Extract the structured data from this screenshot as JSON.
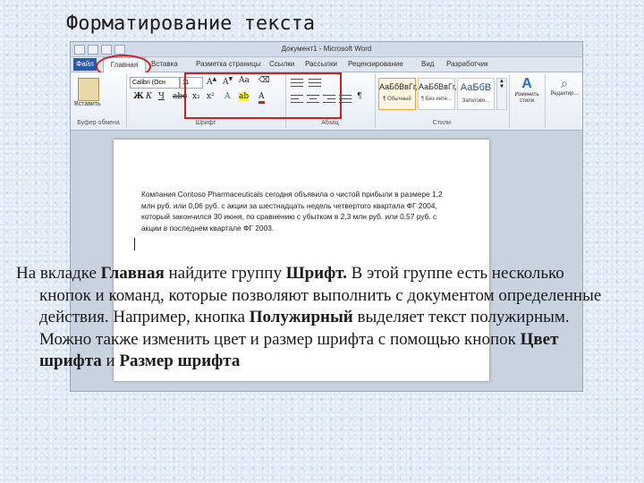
{
  "slide": {
    "title": "Форматирование текста"
  },
  "window": {
    "title": "Документ1 - Microsoft Word"
  },
  "tabs": {
    "file": "Файл",
    "home": "Главная",
    "items": [
      "Вставка",
      "Разметка страницы",
      "Ссылки",
      "Рассылки",
      "Рецензирование",
      "Вид",
      "Разработчик"
    ]
  },
  "ribbon": {
    "clipboard": {
      "paste_label": "Вставить",
      "group_label": "Буфер обмена"
    },
    "font": {
      "font_name": "Calibri (Осн",
      "font_size": "11",
      "group_label": "Шрифт"
    },
    "paragraph": {
      "group_label": "Абзац"
    },
    "styles": {
      "items": [
        {
          "sample": "АаБбВвГг,",
          "name": "¶ Обычный"
        },
        {
          "sample": "АаБбВвГг,",
          "name": "¶ Без инте..."
        },
        {
          "sample": "АаБбВ",
          "name": "Заголово..."
        }
      ],
      "change_styles": "Изменить стили",
      "group_label": "Стили"
    },
    "editing": {
      "label": "Редактир..."
    }
  },
  "document": {
    "paragraph": "Компания Contoso Pharmaceuticals сегодня объявила о чистой прибыли в размере 1,2 млн руб. или 0,06 руб. с акции за шестнадцать недель четвертого квартала ФГ 2004, который закончился 30 июня, по сравнению с убытком в 2,3 млн руб. или 0,57 руб. с акции в последнем квартале ФГ 2003."
  },
  "caption": {
    "p1": "На вкладке ",
    "home_bold": "Главная",
    "p2": " найдите группу ",
    "font_bold": "Шрифт.",
    "p3": " В этой группе есть несколько кнопок и команд, которые позволяют выполнить с документом определенные действия. Например, кнопка ",
    "bold_bold": "Полужирный",
    "p4": "  выделяет текст полужирным. Можно также изменить цвет и размер шрифта с помощью кнопок ",
    "color_bold": "Цвет шрифта",
    "p5": "  и ",
    "size_bold": "Размер шрифта"
  }
}
